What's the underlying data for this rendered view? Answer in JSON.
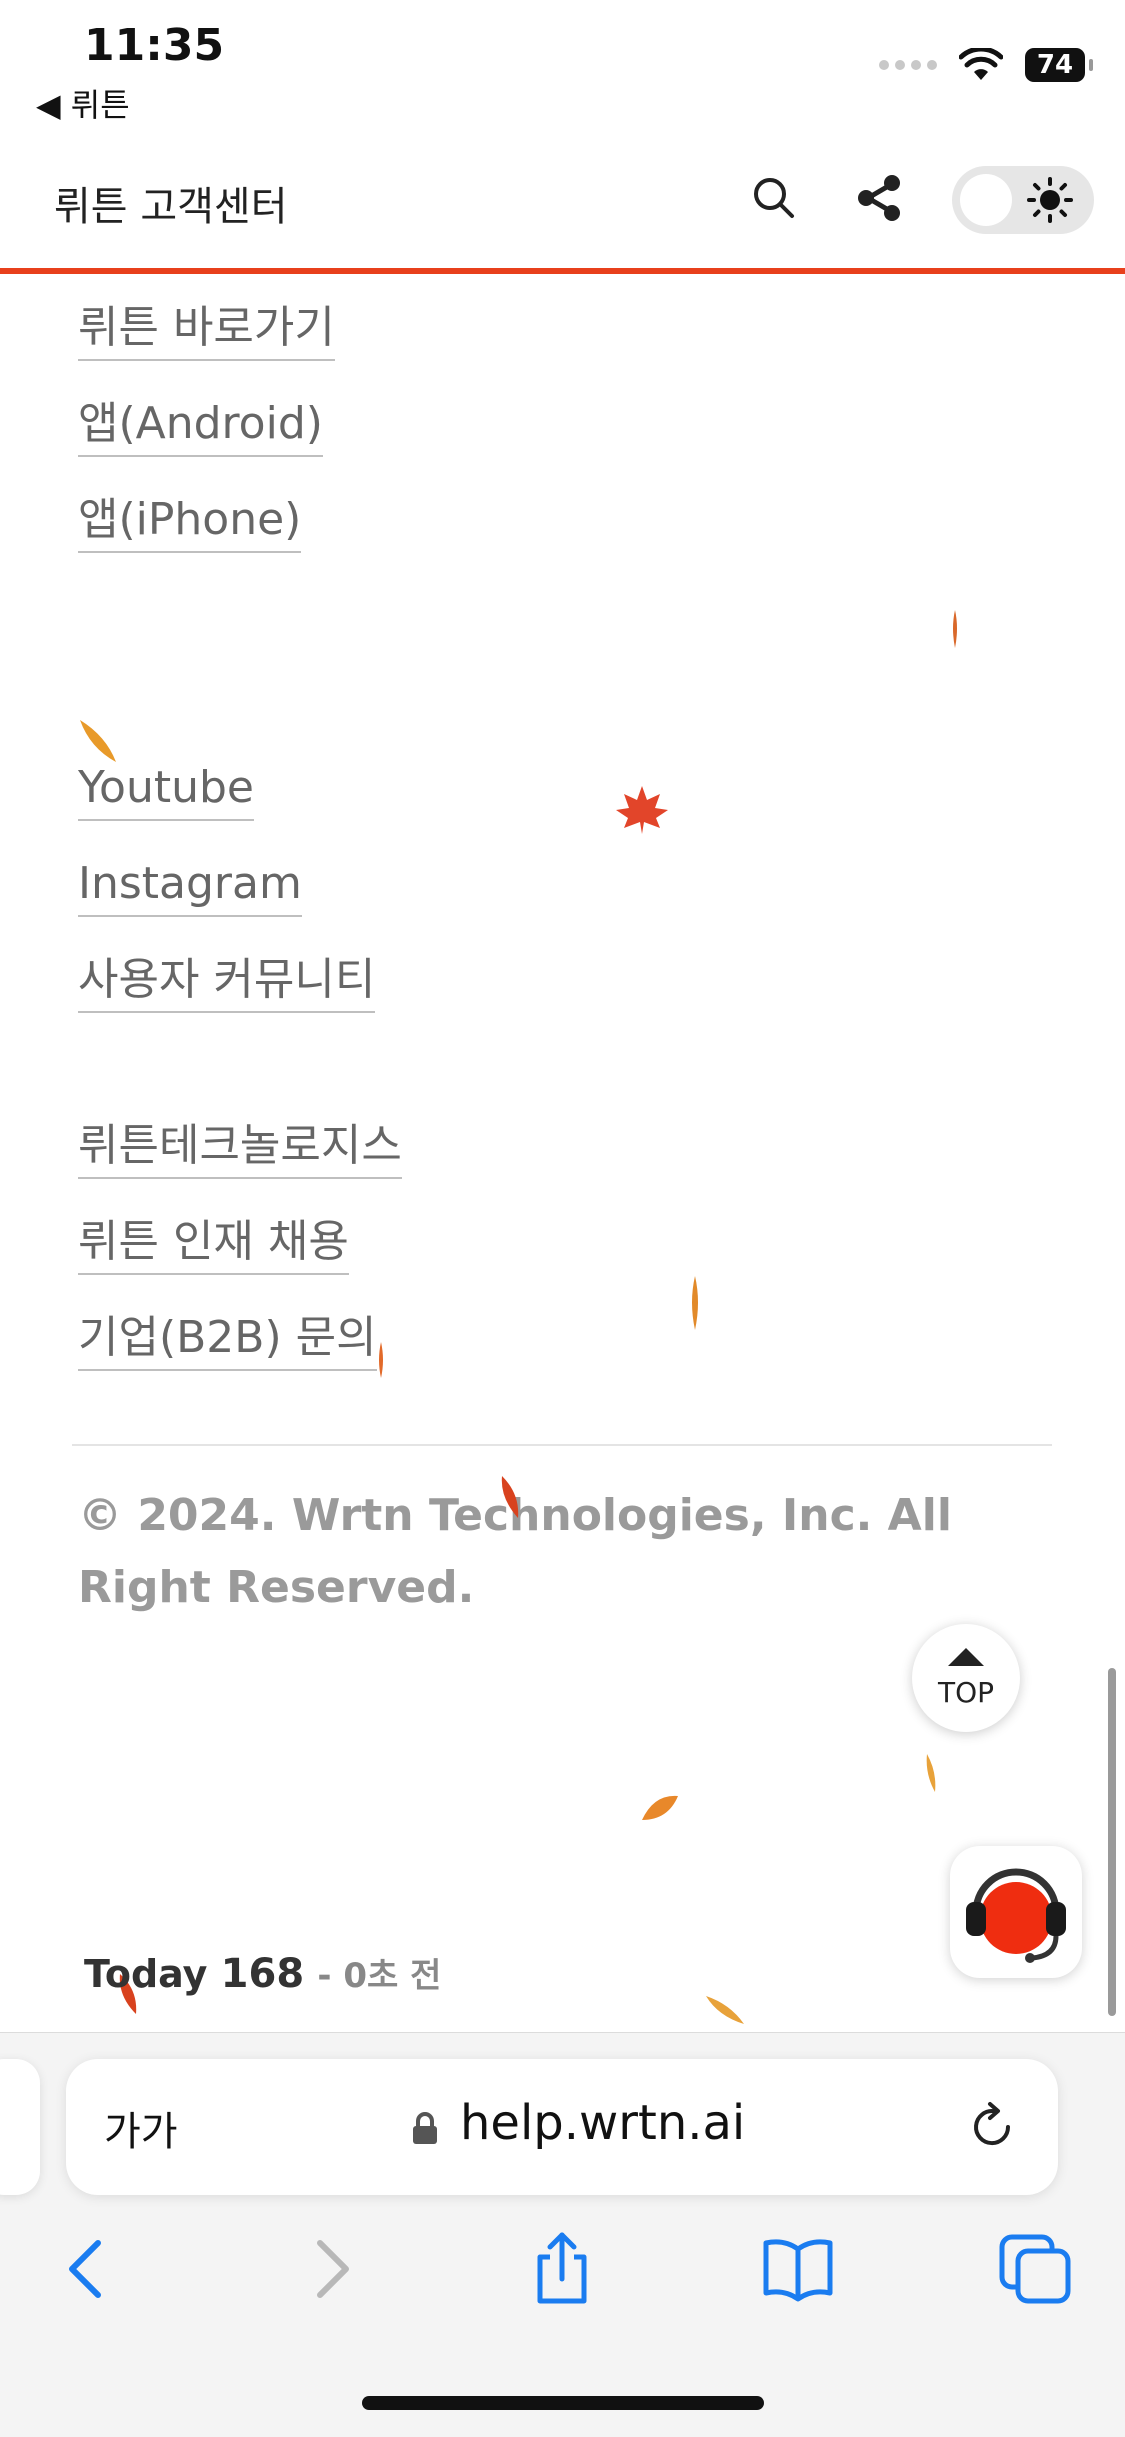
{
  "status_bar": {
    "time": "11:35",
    "back_label": "◀ 뤼튼",
    "battery": "74"
  },
  "header": {
    "title": "뤼튼 고객센터"
  },
  "links": {
    "group1": [
      "뤼튼 바로가기",
      "앱(Android)",
      "앱(iPhone)"
    ],
    "group2": [
      "Youtube",
      "Instagram",
      "사용자 커뮤니티"
    ],
    "group3": [
      "뤼튼테크놀로지스",
      "뤼튼 인재 채용",
      "기업(B2B) 문의"
    ]
  },
  "footer": {
    "copyright": "© 2024. Wrtn Technologies, Inc. All Right Reserved.",
    "top_label": "TOP",
    "today_label": "Today",
    "today_count": "168",
    "today_ago": "- 0초 전"
  },
  "browser": {
    "reader_label": "가가",
    "url": "help.wrtn.ai"
  },
  "colors": {
    "accent": "#e8401c",
    "link": "#666666",
    "muted": "#9a9a9a"
  },
  "icons": [
    "search-icon",
    "share-icon",
    "sun-icon",
    "headset-icon",
    "lock-icon",
    "reload-icon",
    "back-icon",
    "forward-icon",
    "share-sheet-icon",
    "bookmarks-icon",
    "tabs-icon"
  ]
}
